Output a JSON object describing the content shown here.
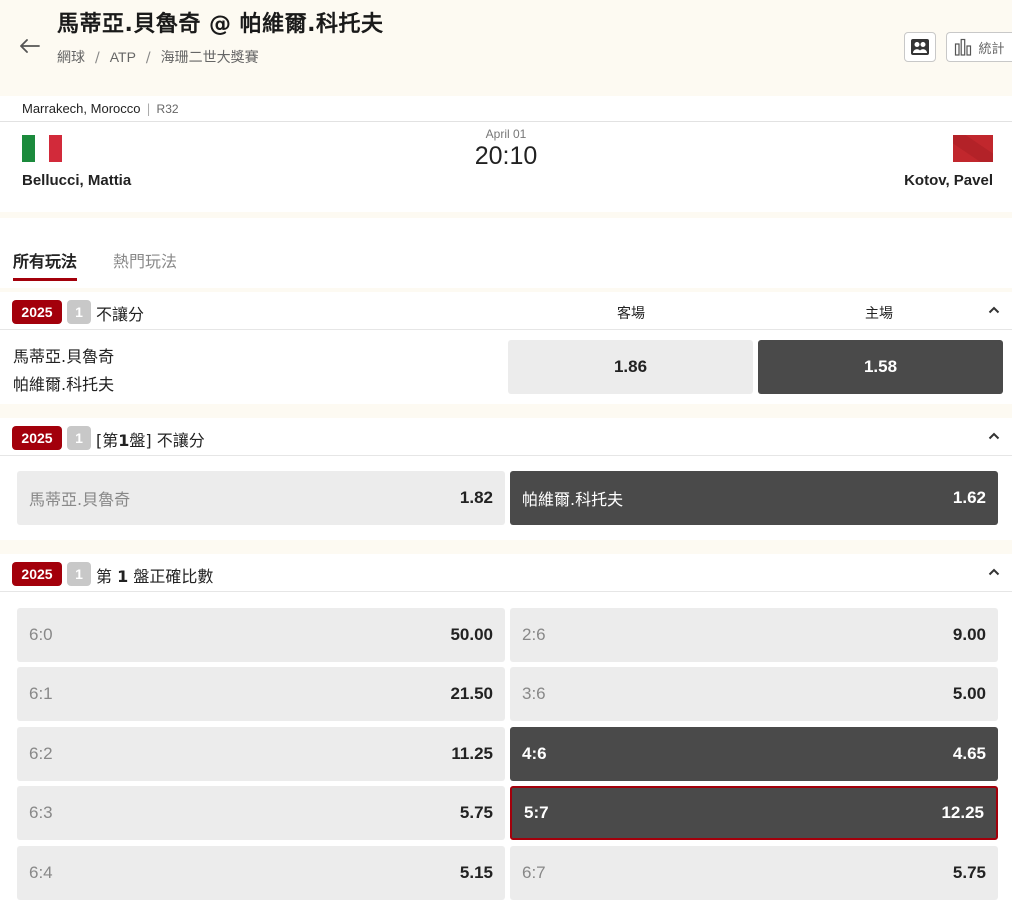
{
  "header": {
    "title": "馬蒂亞.貝魯奇 @ 帕維爾.科托夫",
    "breadcrumb": [
      "網球",
      "ATP",
      "海珊二世大獎賽"
    ],
    "stats_label": "統計"
  },
  "match": {
    "venue": "Marrakech, Morocco",
    "round": "R32",
    "date": "April 01",
    "time": "20:10",
    "home_player": "Bellucci, Mattia",
    "away_player": "Kotov, Pavel",
    "home_flag": "italy-flag",
    "away_flag": "morocco-flag"
  },
  "tabs": [
    {
      "label": "所有玩法",
      "active": true
    },
    {
      "label": "熱門玩法",
      "active": false
    }
  ],
  "colors": {
    "accent": "#a3000b",
    "dark_odds": "#4a4a4a",
    "light_odds": "#ececec",
    "cream": "#fdfaf2"
  },
  "markets": [
    {
      "year": "2025",
      "num": "1",
      "name": "不讓分",
      "col_away": "客場",
      "col_home": "主場",
      "teams": [
        "馬蒂亞.貝魯奇",
        "帕維爾.科托夫"
      ],
      "odds": [
        "1.86",
        "1.58"
      ]
    },
    {
      "year": "2025",
      "num": "1",
      "name_prefix": "[第",
      "name_bold": "1",
      "name_suffix": "盤] 不讓分",
      "outcomes": [
        {
          "label": "馬蒂亞.貝魯奇",
          "odds": "1.82"
        },
        {
          "label": "帕維爾.科托夫",
          "odds": "1.62"
        }
      ]
    },
    {
      "year": "2025",
      "num": "1",
      "name_prefix": "第 ",
      "name_bold": "1",
      "name_suffix": " 盤正確比數",
      "rows": [
        {
          "left_label": "6:0",
          "left_odds": "50.00",
          "right_label": "2:6",
          "right_odds": "9.00"
        },
        {
          "left_label": "6:1",
          "left_odds": "21.50",
          "right_label": "3:6",
          "right_odds": "5.00"
        },
        {
          "left_label": "6:2",
          "left_odds": "11.25",
          "right_label": "4:6",
          "right_odds": "4.65"
        },
        {
          "left_label": "6:3",
          "left_odds": "5.75",
          "right_label": "5:7",
          "right_odds": "12.25"
        },
        {
          "left_label": "6:4",
          "left_odds": "5.15",
          "right_label": "6:7",
          "right_odds": "5.75"
        }
      ]
    }
  ]
}
